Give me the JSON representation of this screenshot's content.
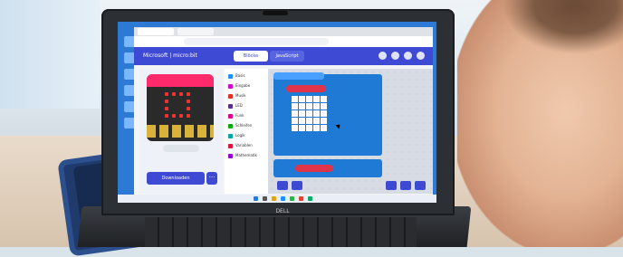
{
  "scene": {
    "app": {
      "brand": "Microsoft | micro:bit",
      "mode_buttons": [
        "Blöcke",
        "JavaScript"
      ],
      "download_label": "Downloaden",
      "more_label": "···",
      "categories": [
        {
          "name": "Basis",
          "color": "#1e90ff"
        },
        {
          "name": "Eingabe",
          "color": "#d400d4"
        },
        {
          "name": "Musik",
          "color": "#e63022"
        },
        {
          "name": "LED",
          "color": "#5c2d91"
        },
        {
          "name": "Funk",
          "color": "#e3008c"
        },
        {
          "name": "Schleifen",
          "color": "#00aa00"
        },
        {
          "name": "Logik",
          "color": "#00a4a6"
        },
        {
          "name": "Variablen",
          "color": "#dc143c"
        },
        {
          "name": "Mathematik",
          "color": "#9400d3"
        }
      ]
    },
    "colors": {
      "app_header": "#3f4ad4",
      "code_block": "#1f7ad6",
      "red_block": "#e0344b",
      "board_accent": "#ff2a6b"
    }
  }
}
